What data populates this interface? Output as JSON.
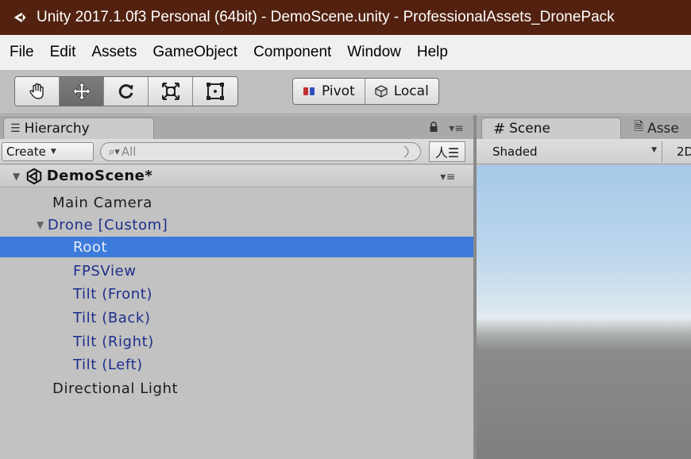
{
  "window": {
    "title": "Unity 2017.1.0f3 Personal (64bit) - DemoScene.unity - ProfessionalAssets_DronePack"
  },
  "menubar": {
    "items": [
      "File",
      "Edit",
      "Assets",
      "GameObject",
      "Component",
      "Window",
      "Help"
    ]
  },
  "toolbar": {
    "tools": [
      "hand-icon",
      "move-icon",
      "rotate-icon",
      "scale-icon",
      "rect-icon"
    ],
    "active_tool": "move-icon",
    "pivot_label": "Pivot",
    "local_label": "Local"
  },
  "hierarchy": {
    "tab_label": "Hierarchy",
    "create_label": "Create",
    "search_placeholder": "All",
    "scene_name": "DemoScene*",
    "items": [
      {
        "label": "Main Camera"
      },
      {
        "label": "Drone [Custom]"
      },
      {
        "label": "Root"
      },
      {
        "label": "FPSView"
      },
      {
        "label": "Tilt (Front)"
      },
      {
        "label": "Tilt (Back)"
      },
      {
        "label": "Tilt (Right)"
      },
      {
        "label": "Tilt (Left)"
      },
      {
        "label": "Directional Light"
      }
    ],
    "selected": "Root"
  },
  "scene": {
    "tab_label": "Scene",
    "asset_tab_label": "Asse",
    "shading_mode": "Shaded",
    "mode_2d": "2D"
  },
  "colors": {
    "titlebar": "#52210f",
    "selection": "#3d7bda",
    "prefab_text": "#1d2f8c"
  }
}
